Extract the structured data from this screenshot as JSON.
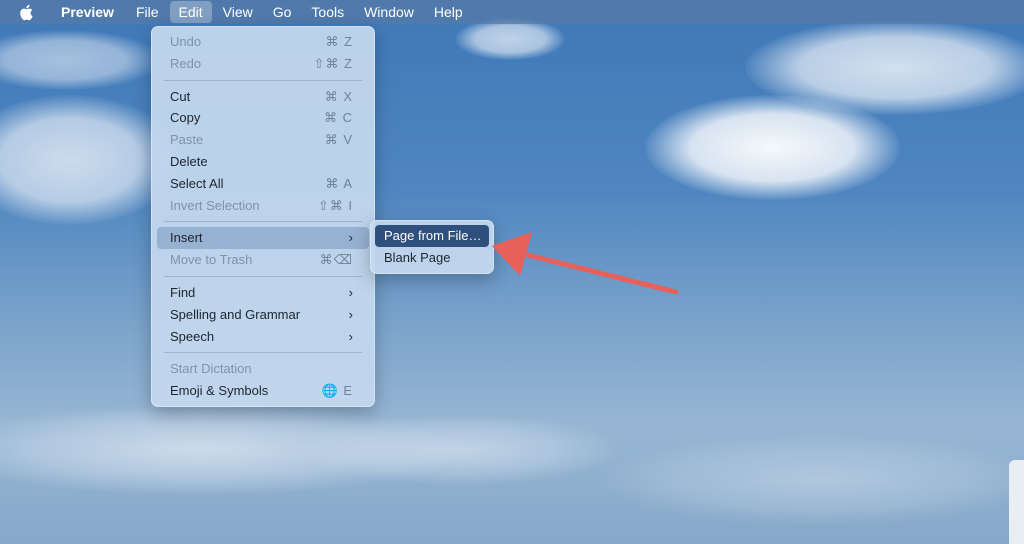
{
  "menubar": {
    "apple_icon": "apple-icon",
    "app_name": "Preview",
    "items": [
      "File",
      "Edit",
      "View",
      "Go",
      "Tools",
      "Window",
      "Help"
    ],
    "active_menu": "Edit"
  },
  "edit_menu": {
    "items": [
      {
        "label": "Undo",
        "shortcut": "⌘ Z",
        "enabled": false
      },
      {
        "label": "Redo",
        "shortcut": "⇧⌘ Z",
        "enabled": false
      },
      {
        "label": "Cut",
        "shortcut": "⌘ X",
        "enabled": true
      },
      {
        "label": "Copy",
        "shortcut": "⌘ C",
        "enabled": true
      },
      {
        "label": "Paste",
        "shortcut": "⌘ V",
        "enabled": false
      },
      {
        "label": "Delete",
        "shortcut": "",
        "enabled": true
      },
      {
        "label": "Select All",
        "shortcut": "⌘ A",
        "enabled": true
      },
      {
        "label": "Invert Selection",
        "shortcut": "⇧⌘ I",
        "enabled": false
      },
      {
        "label": "Insert",
        "submenu_indicator": "›",
        "enabled": true,
        "highlighted": true
      },
      {
        "label": "Move to Trash",
        "shortcut": "⌘⌫",
        "enabled": false
      },
      {
        "label": "Find",
        "submenu_indicator": "›",
        "enabled": true
      },
      {
        "label": "Spelling and Grammar",
        "submenu_indicator": "›",
        "enabled": true
      },
      {
        "label": "Speech",
        "submenu_indicator": "›",
        "enabled": true
      },
      {
        "label": "Start Dictation",
        "shortcut": "",
        "enabled": false
      },
      {
        "label": "Emoji & Symbols",
        "shortcut": "🌐 E",
        "enabled": true
      }
    ]
  },
  "insert_submenu": {
    "items": [
      {
        "label": "Page from File…",
        "selected": true
      },
      {
        "label": "Blank Page",
        "selected": false
      }
    ]
  },
  "annotation": {
    "arrow_color": "#e8605a",
    "arrow_icon": "arrow-pointer-icon"
  }
}
